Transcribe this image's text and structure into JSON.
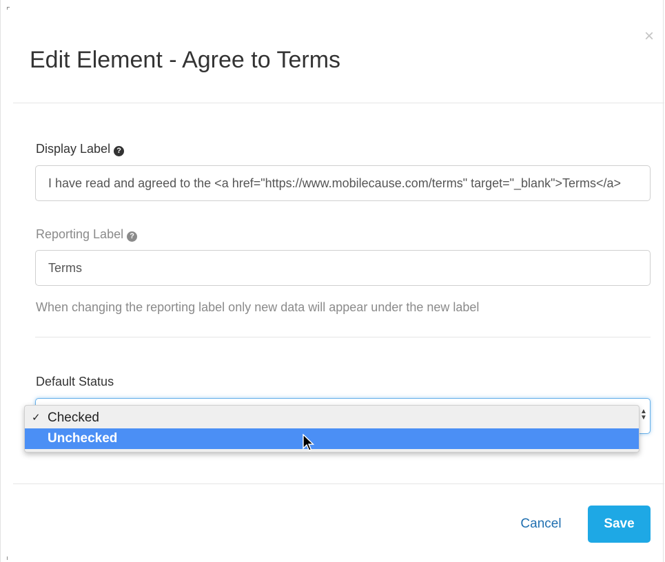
{
  "modal": {
    "title": "Edit Element - Agree to Terms",
    "close_glyph": "×"
  },
  "display_label": {
    "label": "Display Label",
    "help_glyph": "?",
    "value": "I have read and agreed to the <a href=\"https://www.mobilecause.com/terms\" target=\"_blank\">Terms</a>"
  },
  "reporting_label": {
    "label": "Reporting Label",
    "help_glyph": "?",
    "value": "Terms",
    "help_text": "When changing the reporting label only new data will appear under the new label"
  },
  "default_status": {
    "label": "Default Status",
    "selected": "Checked",
    "options": [
      {
        "label": "Checked",
        "checked": true,
        "highlighted": false
      },
      {
        "label": "Unchecked",
        "checked": false,
        "highlighted": true
      }
    ],
    "check_glyph": "✓"
  },
  "footer": {
    "cancel_label": "Cancel",
    "save_label": "Save"
  },
  "colors": {
    "primary": "#1ea8e5",
    "highlight": "#4b8ff5",
    "link": "#1f6fb0"
  }
}
